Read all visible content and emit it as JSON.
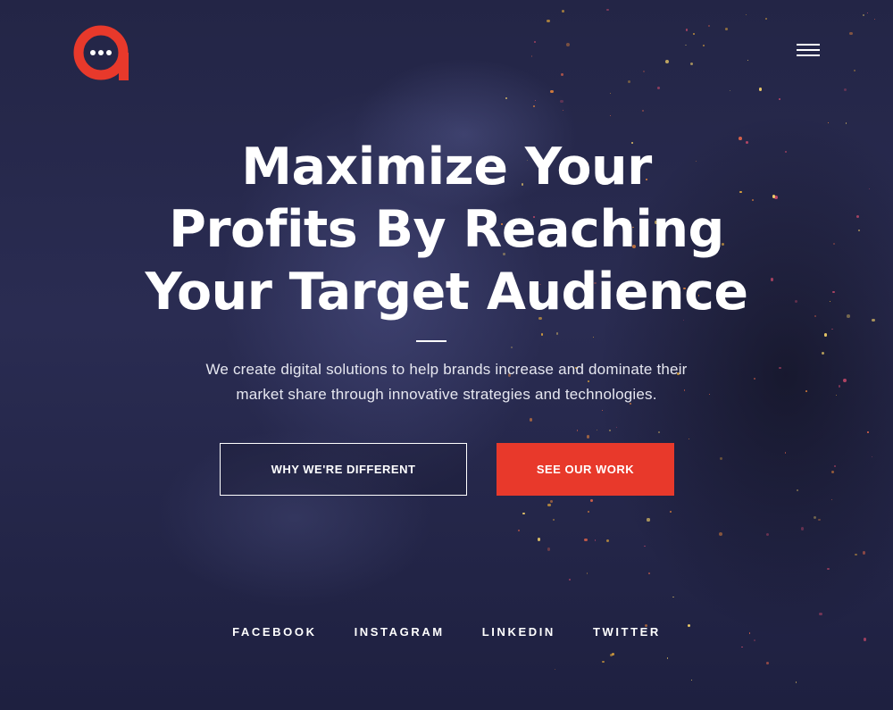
{
  "brand": {
    "logo_icon": "chat-bubble-a-logo",
    "accent_color": "#e8392b"
  },
  "header": {
    "menu_icon": "hamburger-menu-icon"
  },
  "hero": {
    "headline_lines": [
      "Maximize Your",
      "Profits By Reaching",
      "Your Target Audience"
    ],
    "subtitle_lines": [
      "We create digital solutions to help brands increase and dominate their",
      "market share through innovative strategies and technologies."
    ]
  },
  "buttons": {
    "secondary_label": "WHY WE'RE DIFFERENT",
    "primary_label": "SEE OUR WORK"
  },
  "social": {
    "links": [
      "FACEBOOK",
      "INSTAGRAM",
      "LINKEDIN",
      "TWITTER"
    ]
  },
  "colors": {
    "background": "#1f2140",
    "primary_button": "#e8392b",
    "text": "#ffffff"
  }
}
